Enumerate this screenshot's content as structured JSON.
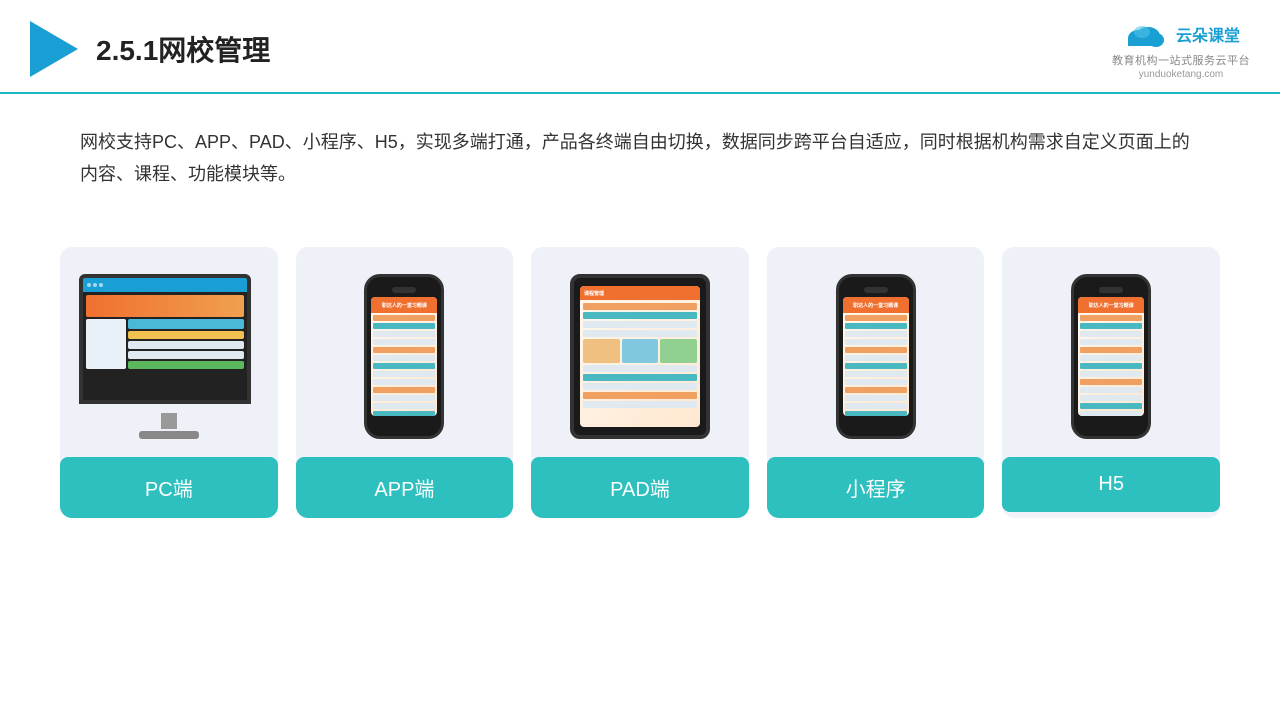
{
  "header": {
    "title": "2.5.1网校管理",
    "brand_name_cn": "云朵课堂",
    "brand_url": "yunduoketang.com",
    "brand_slogan_line1": "教育机构一站",
    "brand_slogan_line2": "式服务云平台"
  },
  "description": {
    "text": "网校支持PC、APP、PAD、小程序、H5，实现多端打通，产品各终端自由切换，数据同步跨平台自适应，同时根据机构需求自定义页面上的内容、课程、功能模块等。"
  },
  "cards": [
    {
      "id": "pc",
      "label": "PC端"
    },
    {
      "id": "app",
      "label": "APP端"
    },
    {
      "id": "pad",
      "label": "PAD端"
    },
    {
      "id": "mini-program",
      "label": "小程序"
    },
    {
      "id": "h5",
      "label": "H5"
    }
  ]
}
